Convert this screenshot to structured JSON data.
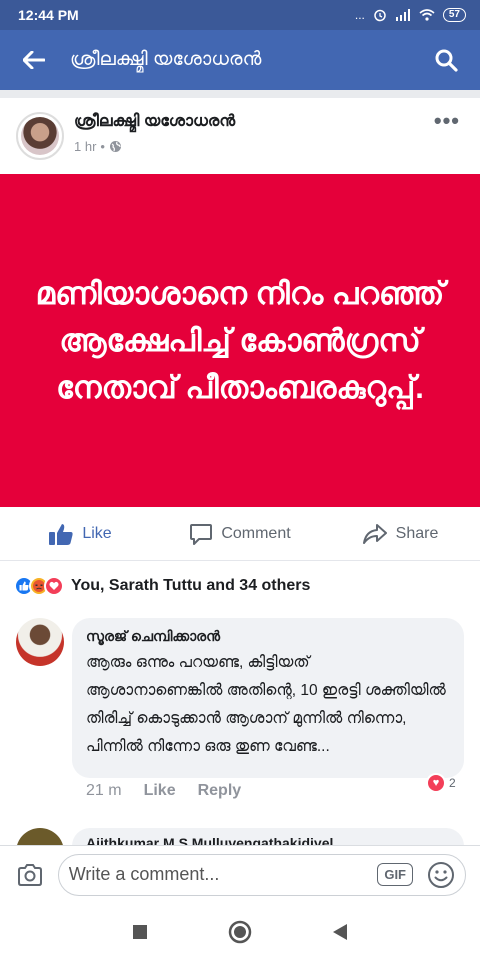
{
  "status": {
    "time": "12:44 PM",
    "dots": "...",
    "battery": "57"
  },
  "header": {
    "title": "ശ്രീലക്ഷ്മി യശോധരൻ"
  },
  "post": {
    "author": "ശ്രീലക്ഷ്മി യശോധരൻ",
    "time": "1 hr",
    "separator": "•",
    "card_text": "മണിയാശാനെ നിറം പറഞ്ഞ് ആക്ഷേപിച്ച് കോൺഗ്രസ് നേതാവ് പീതാംബരകുറുപ്പ്.",
    "card_color": "#e5003a"
  },
  "actions": {
    "like": "Like",
    "comment": "Comment",
    "share": "Share"
  },
  "reactions": {
    "summary": "You, Sarath Tuttu and 34 others"
  },
  "comments": [
    {
      "name": "സൂരജ് ചെമ്പിക്കാരൻ",
      "text": "ആരും ഒന്നും പറയണ്ട, കിട്ടിയത് ആശാനാണെങ്കിൽ അതിന്റെ, 10 ഇരട്ടി ശക്തിയിൽ തിരിച്ച് കൊടുക്കാൻ ആശാന് മുന്നിൽ നിന്നൊ, പിന്നിൽ നിന്നോ ഒരു തുണ വേണ്ട...",
      "time": "21 m",
      "like": "Like",
      "reply": "Reply",
      "reaction_count": "2"
    },
    {
      "name": "Ajithkumar M S Mulluvengathakidiyel"
    }
  ],
  "composer": {
    "placeholder": "Write a comment...",
    "gif": "GIF"
  },
  "colors": {
    "header": "#4267b2",
    "statusbar": "#3b5998",
    "link_blue": "#4267b2"
  }
}
